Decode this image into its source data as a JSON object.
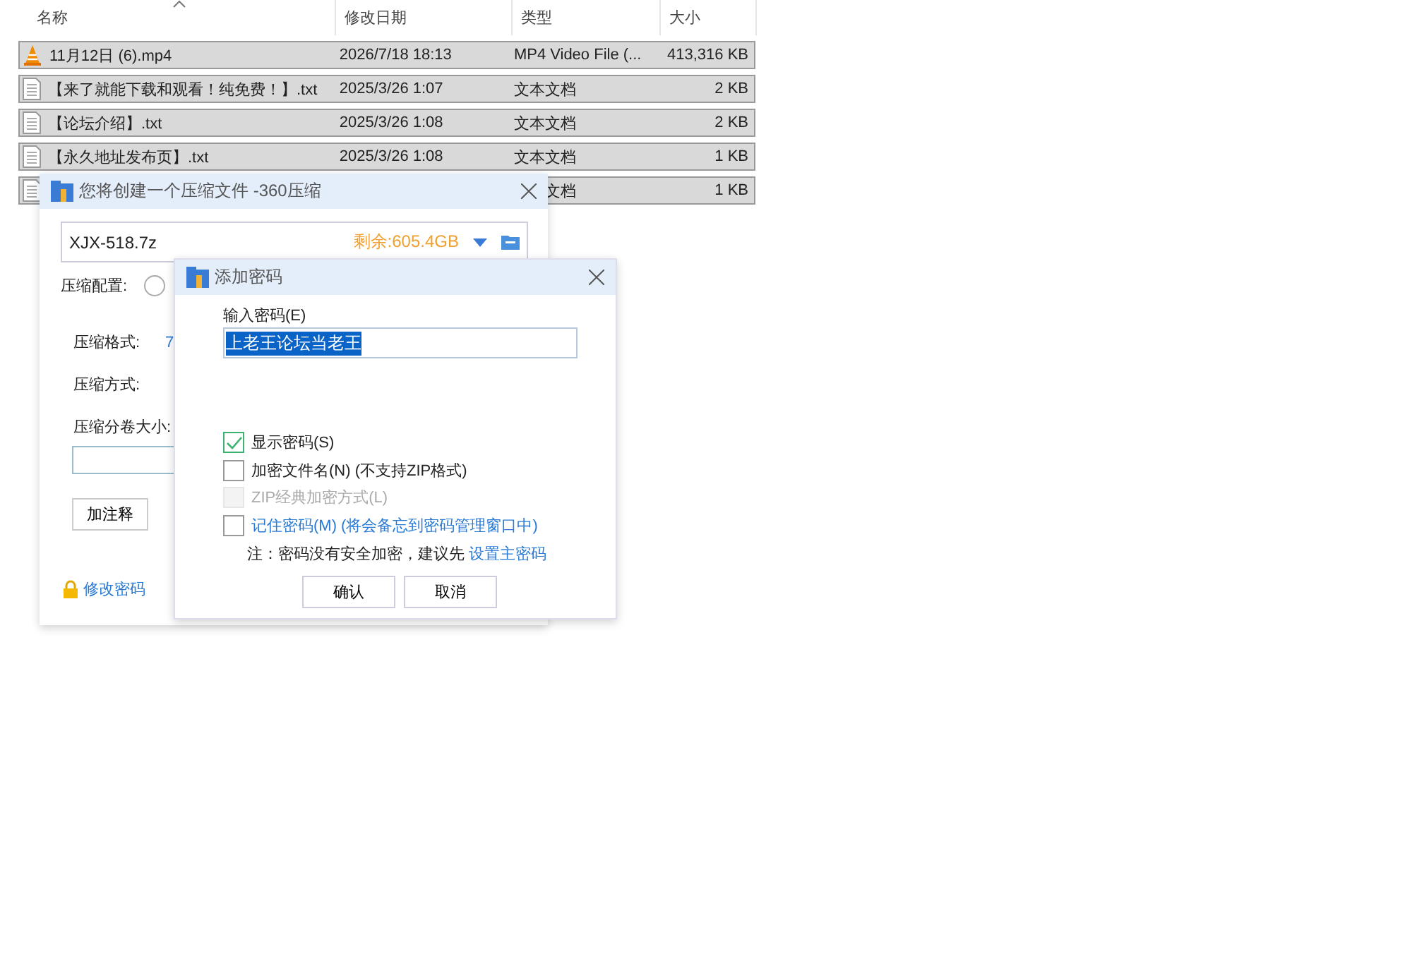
{
  "explorer": {
    "columns": [
      {
        "label": "名称",
        "sorted": true
      },
      {
        "label": "修改日期",
        "sorted": false
      },
      {
        "label": "类型",
        "sorted": false
      },
      {
        "label": "大小",
        "sorted": false
      }
    ],
    "rows": [
      {
        "kind": "video",
        "name": "11月12日 (6).mp4",
        "date": "2026/7/18 18:13",
        "type": "MP4 Video File (...",
        "size": "413,316 KB",
        "selected": true
      },
      {
        "kind": "text",
        "name": "【来了就能下载和观看！纯免费！】.txt",
        "date": "2025/3/26 1:07",
        "type": "文本文档",
        "size": "2 KB",
        "selected": true
      },
      {
        "kind": "text",
        "name": "【论坛介绍】.txt",
        "date": "2025/3/26 1:08",
        "type": "文本文档",
        "size": "2 KB",
        "selected": true
      },
      {
        "kind": "text",
        "name": "【永久地址发布页】.txt",
        "date": "2025/3/26 1:08",
        "type": "文本文档",
        "size": "1 KB",
        "selected": true
      },
      {
        "kind": "text",
        "type": "文档",
        "size": "1 KB",
        "selected": true
      }
    ]
  },
  "compress_dialog": {
    "title": "您将创建一个压缩文件 -360压缩",
    "filename": "XJX-518.7z",
    "free_space": "剩余:605.4GB",
    "config_label": "压缩配置:",
    "config_selected": false,
    "format_label": "压缩格式:",
    "format_value": "7",
    "method_label": "压缩方式:",
    "volume_label": "压缩分卷大小:",
    "comment_button": "加注释",
    "change_password": "修改密码"
  },
  "password_dialog": {
    "title": "添加密码",
    "input_label": "输入密码(E)",
    "password": "上老王论坛当老王",
    "options": [
      {
        "label": "显示密码(S)",
        "checked": true,
        "disabled": false,
        "link": false
      },
      {
        "label": "加密文件名(N) (不支持ZIP格式)",
        "checked": false,
        "disabled": false,
        "link": false
      },
      {
        "label": "ZIP经典加密方式(L)",
        "checked": false,
        "disabled": true,
        "link": false
      },
      {
        "label": "记住密码(M) (将会备忘到密码管理窗口中)",
        "checked": false,
        "disabled": false,
        "link": true
      }
    ],
    "note": "注：密码没有安全加密，建议先",
    "note_link": "设置主密码",
    "buttons": [
      "确认",
      "取消"
    ]
  }
}
